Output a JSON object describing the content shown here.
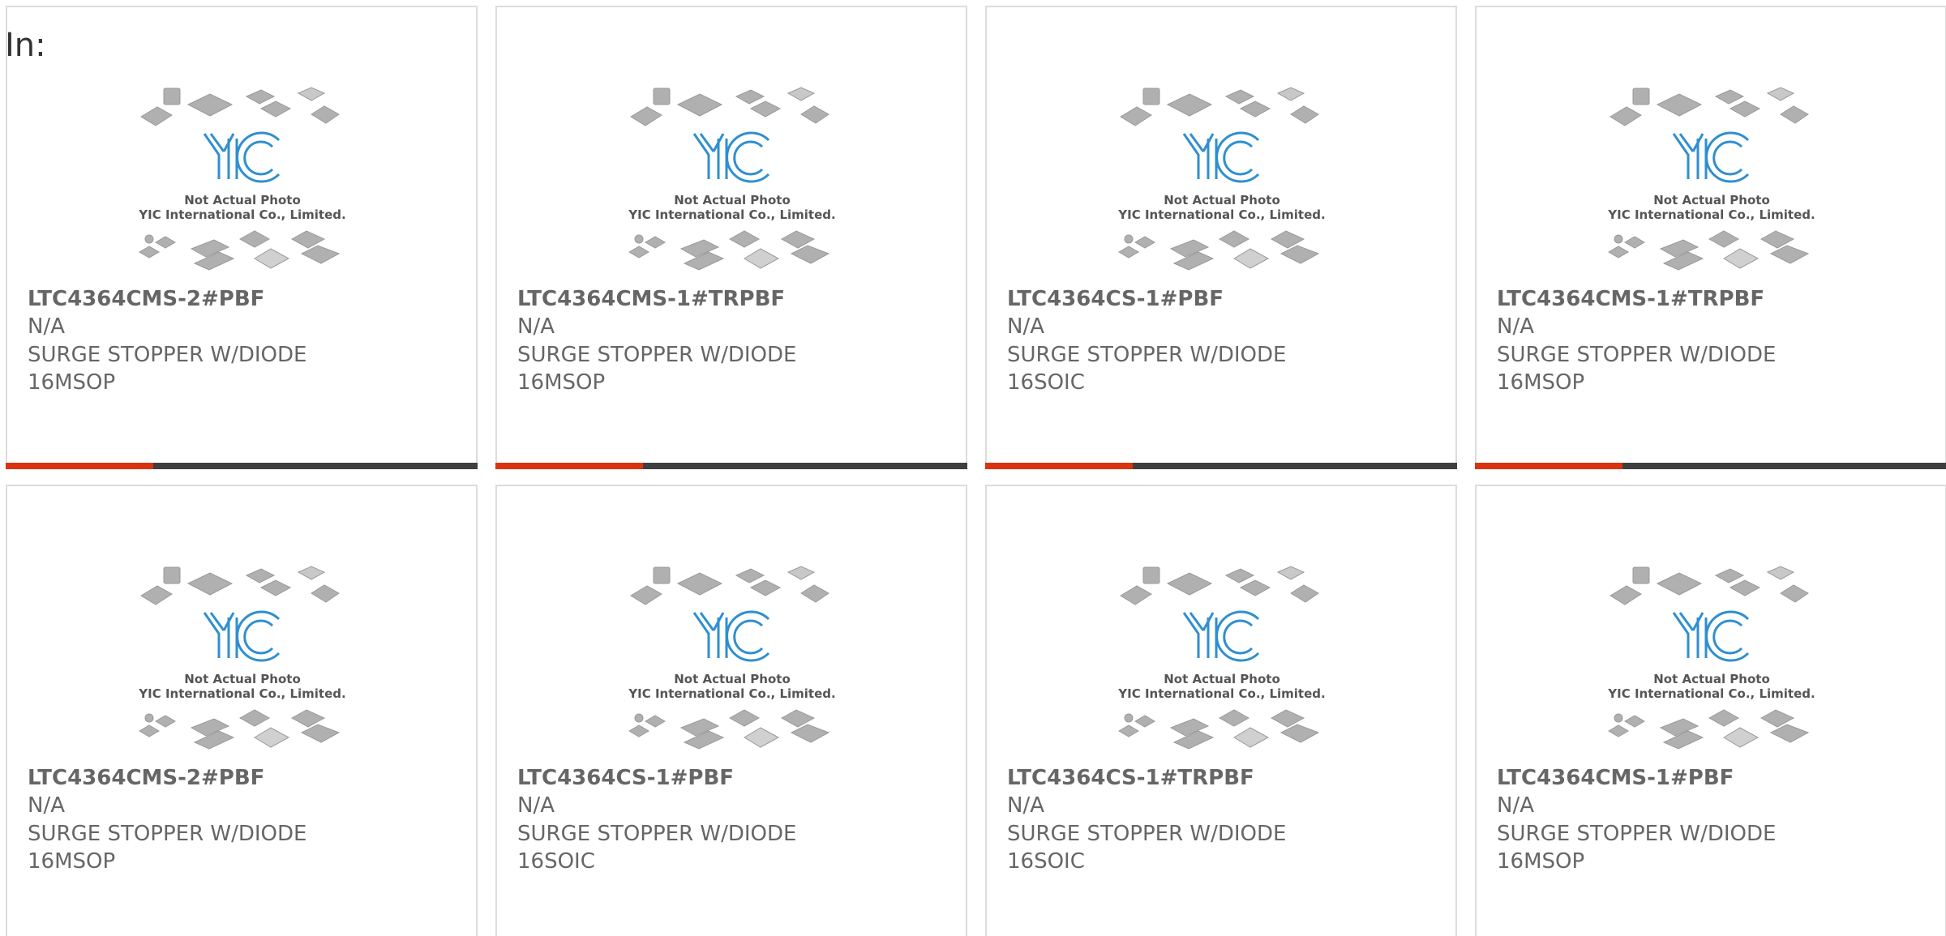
{
  "filter": {
    "label": "In:"
  },
  "photo": {
    "line1": "Not Actual Photo",
    "line2": "YIC International Co., Limited.",
    "logo": "YIC"
  },
  "colors": {
    "accent_bar": "#d9340f",
    "bar": "#3f3f3f",
    "logo_blue": "#2f8fd0",
    "text": "#666666"
  },
  "products": [
    {
      "part": "LTC4364CMS-2#PBF",
      "manufacturer": "N/A",
      "description": "SURGE STOPPER W/DIODE",
      "package": "16MSOP"
    },
    {
      "part": "LTC4364CMS-1#TRPBF",
      "manufacturer": "N/A",
      "description": "SURGE STOPPER W/DIODE",
      "package": "16MSOP"
    },
    {
      "part": "LTC4364CS-1#PBF",
      "manufacturer": "N/A",
      "description": "SURGE STOPPER W/DIODE",
      "package": "16SOIC"
    },
    {
      "part": "LTC4364CMS-1#TRPBF",
      "manufacturer": "N/A",
      "description": "SURGE STOPPER W/DIODE",
      "package": "16MSOP"
    },
    {
      "part": "LTC4364CMS-2#PBF",
      "manufacturer": "N/A",
      "description": "SURGE STOPPER W/DIODE",
      "package": "16MSOP"
    },
    {
      "part": "LTC4364CS-1#PBF",
      "manufacturer": "N/A",
      "description": "SURGE STOPPER W/DIODE",
      "package": "16SOIC"
    },
    {
      "part": "LTC4364CS-1#TRPBF",
      "manufacturer": "N/A",
      "description": "SURGE STOPPER W/DIODE",
      "package": "16SOIC"
    },
    {
      "part": "LTC4364CMS-1#PBF",
      "manufacturer": "N/A",
      "description": "SURGE STOPPER W/DIODE",
      "package": "16MSOP"
    }
  ]
}
